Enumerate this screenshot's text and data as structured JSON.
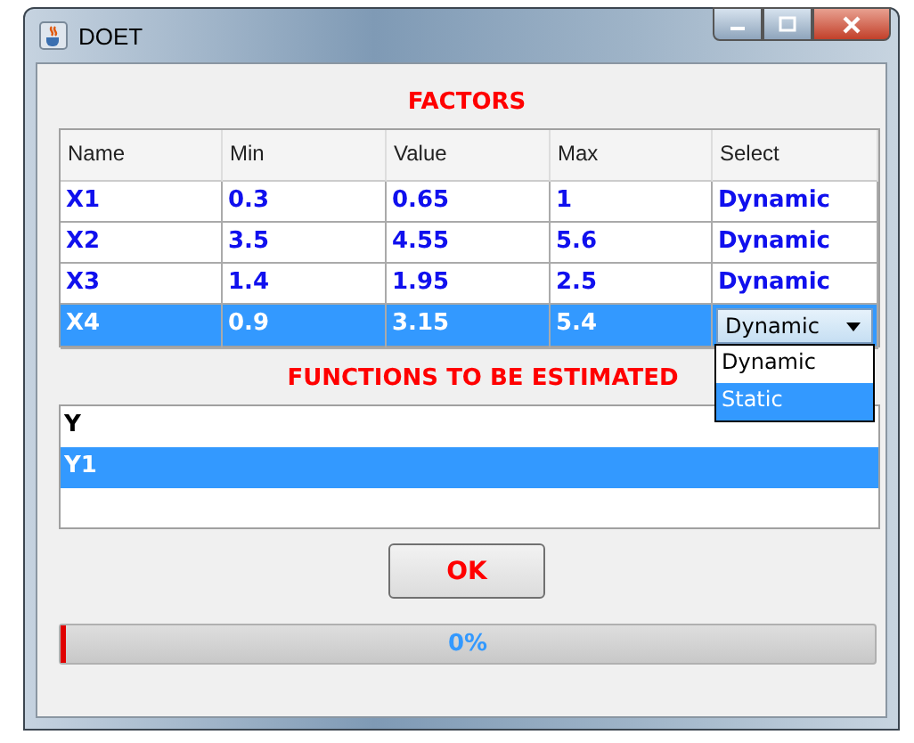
{
  "window": {
    "title": "DOET"
  },
  "factors": {
    "title": "FACTORS",
    "columns": [
      "Name",
      "Min",
      "Value",
      "Max",
      "Select"
    ],
    "rows": [
      {
        "cells": [
          "X1",
          "0.3",
          "0.65",
          "1"
        ],
        "select": "Dynamic",
        "selected": false,
        "open": false
      },
      {
        "cells": [
          "X2",
          "3.5",
          "4.55",
          "5.6"
        ],
        "select": "Dynamic",
        "selected": false,
        "open": false
      },
      {
        "cells": [
          "X3",
          "1.4",
          "1.95",
          "2.5"
        ],
        "select": "Dynamic",
        "selected": false,
        "open": false
      },
      {
        "cells": [
          "X4",
          "0.9",
          "3.15",
          "5.4"
        ],
        "select": "Dynamic",
        "selected": true,
        "open": true
      }
    ],
    "dropdown_options": [
      {
        "label": "Dynamic",
        "selected": false
      },
      {
        "label": "Static",
        "selected": true
      }
    ]
  },
  "functions": {
    "title": "FUNCTIONS TO BE ESTIMATED",
    "items": [
      {
        "label": "Y",
        "selected": false
      },
      {
        "label": "Y1",
        "selected": true
      }
    ]
  },
  "ok_button": "OK",
  "progress": {
    "level": 0,
    "text": "0%"
  }
}
